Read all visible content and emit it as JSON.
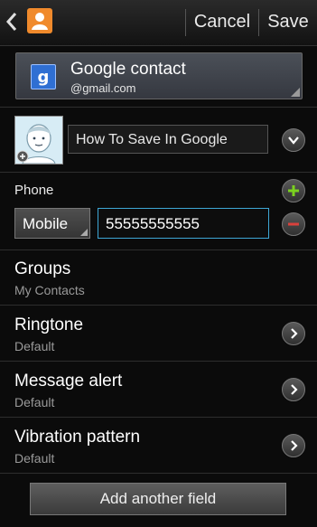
{
  "header": {
    "back_icon": "back-chevron-icon",
    "app_icon": "contact-person-icon",
    "cancel_label": "Cancel",
    "save_label": "Save"
  },
  "account": {
    "title": "Google contact",
    "email": "@gmail.com",
    "icon": "google-g-icon"
  },
  "contact": {
    "name_value": "How To Save In Google",
    "avatar_icon": "default-avatar-icon",
    "expand_icon": "chevron-down-icon"
  },
  "phone": {
    "label": "Phone",
    "type": "Mobile",
    "number": "55555555555",
    "add_icon": "plus-icon",
    "remove_icon": "minus-icon"
  },
  "rows": {
    "groups": {
      "title": "Groups",
      "value": "My Contacts"
    },
    "ringtone": {
      "title": "Ringtone",
      "value": "Default"
    },
    "message_alert": {
      "title": "Message alert",
      "value": "Default"
    },
    "vibration": {
      "title": "Vibration pattern",
      "value": "Default"
    }
  },
  "footer": {
    "add_field_label": "Add another field"
  },
  "colors": {
    "focus_border": "#3ea7d6",
    "plus_green": "#7bd11f",
    "minus_red": "#d9413c",
    "app_icon_orange": "#f08a2c",
    "google_blue": "#2f6fd3"
  }
}
